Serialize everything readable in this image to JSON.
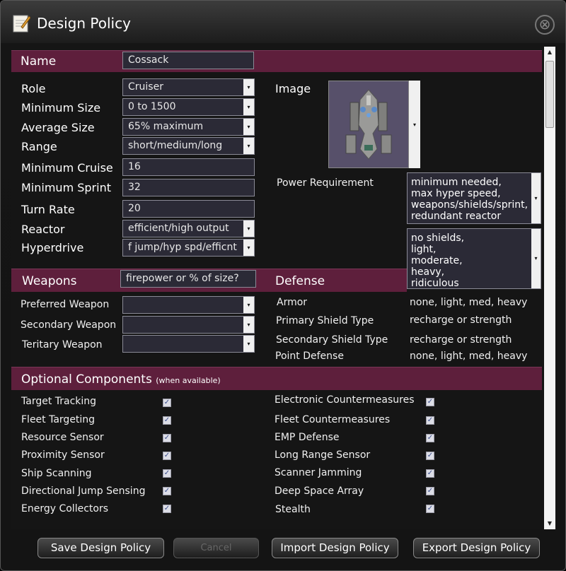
{
  "window": {
    "title": "Design Policy",
    "close_glyph": "⊗"
  },
  "name_band": {
    "label": "Name",
    "value": "Cossack"
  },
  "fields": {
    "role": {
      "label": "Role",
      "value": "Cruiser"
    },
    "min_size": {
      "label": "Minimum Size",
      "value": "0 to 1500"
    },
    "avg_size": {
      "label": "Average Size",
      "value": "65% maximum"
    },
    "range": {
      "label": "Range",
      "value": "short/medium/long"
    },
    "min_cruise": {
      "label": "Minimum Cruise",
      "value": "16"
    },
    "min_sprint": {
      "label": "Minimum Sprint",
      "value": "32"
    },
    "turn_rate": {
      "label": "Turn Rate",
      "value": "20"
    },
    "reactor": {
      "label": "Reactor",
      "value": "efficient/high output"
    },
    "hyperdrive": {
      "label": "Hyperdrive",
      "value": "f jump/hyp spd/efficnt"
    }
  },
  "image": {
    "label": "Image"
  },
  "power": {
    "label": "Power Requirement",
    "options": [
      "minimum needed,",
      "max hyper speed,",
      "weapons/shields/sprint,",
      "redundant reactor"
    ]
  },
  "shields_list": {
    "options": [
      "no shields,",
      "light,",
      "moderate,",
      "heavy,",
      "ridiculous"
    ]
  },
  "weapons": {
    "label": "Weapons",
    "mode_value": "firepower or % of size?",
    "preferred_label": "Preferred Weapon",
    "secondary_label": "Secondary Weapon",
    "tertiary_label": "Teritary Weapon"
  },
  "defense": {
    "label": "Defense",
    "rows": [
      {
        "label": "Armor",
        "value": "none, light, med, heavy"
      },
      {
        "label": "Primary Shield Type",
        "value": "recharge or strength"
      },
      {
        "label": "Secondary Shield Type",
        "value": "recharge or strength"
      },
      {
        "label": "Point Defense",
        "value": "none, light, med, heavy"
      }
    ]
  },
  "optional": {
    "label": "Optional Components",
    "sublabel": "(when available)",
    "left": [
      "Target Tracking",
      "Fleet Targeting",
      "Resource Sensor",
      "Proximity Sensor",
      "Ship Scanning",
      "Directional Jump Sensing",
      "Energy Collectors"
    ],
    "right": [
      "Electronic Countermeasures",
      "Fleet Countermeasures",
      "EMP Defense",
      "Long Range Sensor",
      "Scanner Jamming",
      "Deep Space Array",
      "Stealth"
    ],
    "check_glyph": "✓"
  },
  "buttons": {
    "save": "Save Design Policy",
    "cancel": "Cancel",
    "import": "Import Design Policy",
    "export": "Export Design Policy"
  },
  "glyphs": {
    "dropdown": "▾",
    "up": "▲",
    "down": "▼"
  },
  "colors": {
    "band": "#5e1f3c",
    "field_bg": "#2b2a36"
  }
}
